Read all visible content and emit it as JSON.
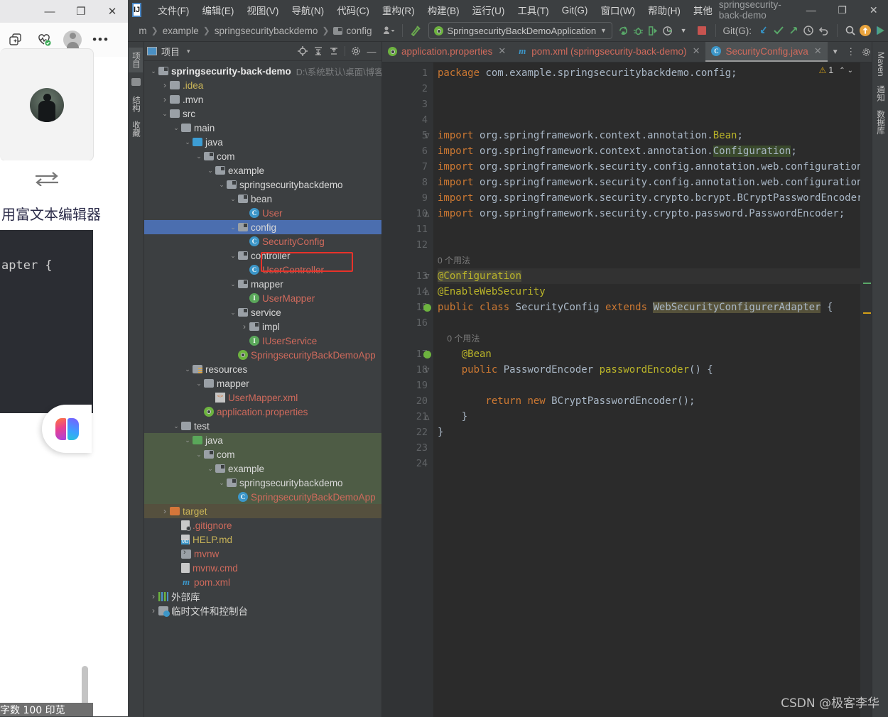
{
  "browser": {
    "window_controls": [
      "—",
      "❐",
      "✕"
    ],
    "toolbar_icons": [
      "collections-add-icon",
      "health-check-icon",
      "profile-avatar-icon",
      "more-options-icon"
    ],
    "card": {
      "avatar": "user-photo"
    },
    "swap_label": "swap-icon",
    "rich_text_label": "用富文本编辑器",
    "code_snippet": "apter {",
    "status_text": "字数  100 印苋",
    "rail_icons": [
      "bell-icon",
      "search-icon",
      "tag-icon",
      "briefcase-icon",
      "chess-icon",
      "copilot-icon",
      "outlook-icon",
      "telegram-icon",
      "plus-icon",
      "snip-icon",
      "settings-icon"
    ],
    "assistant_bubble": "ai-brain-icon"
  },
  "ide": {
    "logo": "IJ",
    "menu": [
      {
        "label": "文件(F)"
      },
      {
        "label": "编辑(E)"
      },
      {
        "label": "视图(V)"
      },
      {
        "label": "导航(N)"
      },
      {
        "label": "代码(C)"
      },
      {
        "label": "重构(R)"
      },
      {
        "label": "构建(B)"
      },
      {
        "label": "运行(U)"
      },
      {
        "label": "工具(T)"
      },
      {
        "label": "Git(G)"
      },
      {
        "label": "窗口(W)"
      },
      {
        "label": "帮助(H)"
      },
      {
        "label": "其他"
      }
    ],
    "window_title": "springsecurity-back-demo",
    "window_controls": [
      "—",
      "❐",
      "✕"
    ],
    "navbar": {
      "breadcrumbs": [
        "m",
        "example",
        "springsecuritybackdemo",
        "config"
      ],
      "profile_icon": "user-dropdown-icon",
      "hammer_icon": "build-hammer-icon",
      "run_config": "SpringsecurityBackDemoApplication",
      "run_icons": [
        "rerun-icon",
        "debug-icon",
        "run-with-coverage-icon",
        "profile-icon"
      ],
      "stop_icon": "stop-icon",
      "git_label": "Git(G):",
      "git_icons": [
        "update-project-icon",
        "commit-icon",
        "push-icon",
        "history-icon",
        "rollback-icon"
      ],
      "search_icon": "search-everywhere-icon",
      "update_icon": "update-badge-icon",
      "ai_icon": "ai-assistant-icon"
    },
    "left_rail_tabs": [
      "项目",
      "结构",
      "收藏"
    ],
    "project_panel": {
      "title": "项目",
      "dropdown": "▾",
      "actions": [
        "locate-icon",
        "expand-all-icon",
        "collapse-all-icon",
        "settings-gear-icon",
        "hide-panel-icon"
      ],
      "root_path_hint": "D:\\系统默认\\桌面\\博客",
      "tree": [
        {
          "indent": 0,
          "arrow": "v",
          "icon": "folder-module",
          "label": "springsecurity-back-demo",
          "style": "bold",
          "hint": "D:\\系统默认\\桌面\\博客"
        },
        {
          "indent": 1,
          "arrow": ">",
          "icon": "folder",
          "label": ".idea",
          "style": "yellow"
        },
        {
          "indent": 1,
          "arrow": ">",
          "icon": "folder",
          "label": ".mvn",
          "style": "white"
        },
        {
          "indent": 1,
          "arrow": "v",
          "icon": "folder",
          "label": "src",
          "style": "white"
        },
        {
          "indent": 2,
          "arrow": "v",
          "icon": "folder",
          "label": "main",
          "style": "white"
        },
        {
          "indent": 3,
          "arrow": "v",
          "icon": "folder-source",
          "label": "java",
          "style": "white"
        },
        {
          "indent": 4,
          "arrow": "v",
          "icon": "package",
          "label": "com",
          "style": "white"
        },
        {
          "indent": 5,
          "arrow": "v",
          "icon": "package",
          "label": "example",
          "style": "white"
        },
        {
          "indent": 6,
          "arrow": "v",
          "icon": "package",
          "label": "springsecuritybackdemo",
          "style": "white"
        },
        {
          "indent": 7,
          "arrow": "v",
          "icon": "package",
          "label": "bean",
          "style": "white"
        },
        {
          "indent": 8,
          "arrow": "",
          "icon": "class",
          "label": "User",
          "style": "red"
        },
        {
          "indent": 7,
          "arrow": "v",
          "icon": "package",
          "label": "config",
          "style": "white",
          "row": "selected"
        },
        {
          "indent": 8,
          "arrow": "",
          "icon": "class",
          "label": "SecurityConfig",
          "style": "red",
          "highlight": true
        },
        {
          "indent": 7,
          "arrow": "v",
          "icon": "package",
          "label": "controller",
          "style": "white"
        },
        {
          "indent": 8,
          "arrow": "",
          "icon": "class",
          "label": "UserController",
          "style": "red"
        },
        {
          "indent": 7,
          "arrow": "v",
          "icon": "package",
          "label": "mapper",
          "style": "white"
        },
        {
          "indent": 8,
          "arrow": "",
          "icon": "interface",
          "label": "UserMapper",
          "style": "red"
        },
        {
          "indent": 7,
          "arrow": "v",
          "icon": "package",
          "label": "service",
          "style": "white"
        },
        {
          "indent": 8,
          "arrow": ">",
          "icon": "package",
          "label": "impl",
          "style": "white"
        },
        {
          "indent": 8,
          "arrow": "",
          "icon": "interface",
          "label": "IUserService",
          "style": "red"
        },
        {
          "indent": 7,
          "arrow": "",
          "icon": "spring",
          "label": "SpringsecurityBackDemoApp",
          "style": "red"
        },
        {
          "indent": 3,
          "arrow": "v",
          "icon": "folder-resources",
          "label": "resources",
          "style": "white"
        },
        {
          "indent": 4,
          "arrow": "v",
          "icon": "folder",
          "label": "mapper",
          "style": "white"
        },
        {
          "indent": 5,
          "arrow": "",
          "icon": "xml",
          "label": "UserMapper.xml",
          "style": "red"
        },
        {
          "indent": 4,
          "arrow": "",
          "icon": "spring",
          "label": "application.properties",
          "style": "red"
        },
        {
          "indent": 2,
          "arrow": "v",
          "icon": "folder",
          "label": "test",
          "style": "white"
        },
        {
          "indent": 3,
          "arrow": "v",
          "icon": "folder-test",
          "label": "java",
          "style": "white",
          "row": "green"
        },
        {
          "indent": 4,
          "arrow": "v",
          "icon": "package",
          "label": "com",
          "style": "white",
          "row": "green"
        },
        {
          "indent": 5,
          "arrow": "v",
          "icon": "package",
          "label": "example",
          "style": "white",
          "row": "green"
        },
        {
          "indent": 6,
          "arrow": "v",
          "icon": "package",
          "label": "springsecuritybackdemo",
          "style": "white",
          "row": "green"
        },
        {
          "indent": 7,
          "arrow": "",
          "icon": "class",
          "label": "SpringsecurityBackDemoApp",
          "style": "red",
          "row": "green"
        },
        {
          "indent": 1,
          "arrow": ">",
          "icon": "folder-target",
          "label": "target",
          "style": "yellow",
          "row": "brown"
        },
        {
          "indent": 2,
          "arrow": "",
          "icon": "file-git",
          "label": ".gitignore",
          "style": "red"
        },
        {
          "indent": 2,
          "arrow": "",
          "icon": "file-md",
          "label": "HELP.md",
          "style": "yellow"
        },
        {
          "indent": 2,
          "arrow": "",
          "icon": "file-sh",
          "label": "mvnw",
          "style": "red"
        },
        {
          "indent": 2,
          "arrow": "",
          "icon": "file",
          "label": "mvnw.cmd",
          "style": "red"
        },
        {
          "indent": 2,
          "arrow": "",
          "icon": "maven",
          "label": "pom.xml",
          "style": "red"
        },
        {
          "indent": 0,
          "arrow": ">",
          "icon": "library",
          "label": "外部库",
          "style": "white"
        },
        {
          "indent": 0,
          "arrow": ">",
          "icon": "console",
          "label": "临时文件和控制台",
          "style": "white"
        }
      ]
    },
    "editor": {
      "tabs": [
        {
          "label": "application.properties",
          "icon": "spring-icon",
          "active": false
        },
        {
          "label": "pom.xml (springsecurity-back-demo)",
          "icon": "maven-icon",
          "active": false
        },
        {
          "label": "SecurityConfig.java",
          "icon": "class-icon",
          "active": true
        }
      ],
      "tab_tools": [
        "chevron-down-icon",
        "more-vertical-icon",
        "settings-gear-icon",
        "hide-editor-icon"
      ],
      "inspection": {
        "count": "1",
        "warn_icon": "warning-icon",
        "up_icon": "prev-problem-icon",
        "down_icon": "next-problem-icon"
      },
      "lines": [
        {
          "n": 1,
          "segments": [
            {
              "t": "package ",
              "c": "kw"
            },
            {
              "t": "com.example.springsecuritybackdemo.config;",
              "c": "txt"
            }
          ]
        },
        {
          "n": 2,
          "segments": []
        },
        {
          "n": 3,
          "segments": []
        },
        {
          "n": 4,
          "segments": []
        },
        {
          "n": 5,
          "fold": "-",
          "segments": [
            {
              "t": "import ",
              "c": "kw"
            },
            {
              "t": "org.springframework.context.annotation.",
              "c": "txt"
            },
            {
              "t": "Bean",
              "c": "ann"
            },
            {
              "t": ";",
              "c": "txt"
            }
          ]
        },
        {
          "n": 6,
          "segments": [
            {
              "t": "import ",
              "c": "kw"
            },
            {
              "t": "org.springframework.context.annotation.",
              "c": "txt"
            },
            {
              "t": "Configuration",
              "c": "txt mark"
            },
            {
              "t": ";",
              "c": "txt"
            }
          ]
        },
        {
          "n": 7,
          "segments": [
            {
              "t": "import ",
              "c": "kw"
            },
            {
              "t": "org.springframework.security.config.annotation.web.configuration.E",
              "c": "txt"
            }
          ]
        },
        {
          "n": 8,
          "segments": [
            {
              "t": "import ",
              "c": "kw"
            },
            {
              "t": "org.springframework.security.config.annotation.web.configuration.W",
              "c": "txt"
            }
          ]
        },
        {
          "n": 9,
          "segments": [
            {
              "t": "import ",
              "c": "kw"
            },
            {
              "t": "org.springframework.security.crypto.bcrypt.BCryptPasswordEncoder;",
              "c": "txt"
            }
          ]
        },
        {
          "n": 10,
          "fold": "=",
          "segments": [
            {
              "t": "import ",
              "c": "kw"
            },
            {
              "t": "org.springframework.security.crypto.password.PasswordEncoder;",
              "c": "txt"
            }
          ]
        },
        {
          "n": 11,
          "segments": []
        },
        {
          "n": 12,
          "segments": []
        },
        {
          "n": null,
          "segments": [
            {
              "t": "0 个用法",
              "c": "hint"
            }
          ],
          "usage": true
        },
        {
          "n": 13,
          "fold": "-",
          "segments": [
            {
              "t": "@Configuration",
              "c": "ann markc"
            }
          ],
          "current": true
        },
        {
          "n": 14,
          "fold": "=",
          "segments": [
            {
              "t": "@EnableWebSecurity",
              "c": "ann"
            }
          ]
        },
        {
          "n": 15,
          "gutter_icon": "spring-bean-icon",
          "segments": [
            {
              "t": "public ",
              "c": "kw"
            },
            {
              "t": "class ",
              "c": "kw"
            },
            {
              "t": "SecurityConfig ",
              "c": "txt"
            },
            {
              "t": "extends ",
              "c": "kw"
            },
            {
              "t": "WebSecurityConfigurerAdapter",
              "c": "txt markb"
            },
            {
              "t": " {",
              "c": "txt"
            }
          ]
        },
        {
          "n": 16,
          "segments": []
        },
        {
          "n": null,
          "segments": [
            {
              "t": "    0 个用法",
              "c": "hint"
            }
          ],
          "usage": true
        },
        {
          "n": 17,
          "gutter_icon": "spring-bean-icon",
          "segments": [
            {
              "t": "    @Bean",
              "c": "ann"
            }
          ]
        },
        {
          "n": 18,
          "fold": "-",
          "segments": [
            {
              "t": "    public ",
              "c": "kw"
            },
            {
              "t": "PasswordEncoder ",
              "c": "txt"
            },
            {
              "t": "passwordEncoder",
              "c": "ann"
            },
            {
              "t": "() {",
              "c": "txt"
            }
          ]
        },
        {
          "n": 19,
          "segments": []
        },
        {
          "n": 20,
          "segments": [
            {
              "t": "        return ",
              "c": "kw"
            },
            {
              "t": "new ",
              "c": "kw"
            },
            {
              "t": "BCryptPasswordEncoder();",
              "c": "txt"
            }
          ]
        },
        {
          "n": 21,
          "fold": "=",
          "segments": [
            {
              "t": "    }",
              "c": "txt"
            }
          ]
        },
        {
          "n": 22,
          "segments": [
            {
              "t": "}",
              "c": "txt"
            }
          ]
        },
        {
          "n": 23,
          "segments": []
        },
        {
          "n": 24,
          "segments": []
        }
      ]
    },
    "right_rail_tabs": [
      "Maven",
      "通知",
      "数据库"
    ]
  },
  "watermark": "CSDN @极客李华",
  "colors": {
    "selection_blue": "#4b6eaf",
    "highlight_red": "#e8322a",
    "test_green": "#4e5c45",
    "target_brown": "#55503e",
    "editor_bg": "#2b2b2b",
    "panel_bg": "#3c3f41"
  }
}
